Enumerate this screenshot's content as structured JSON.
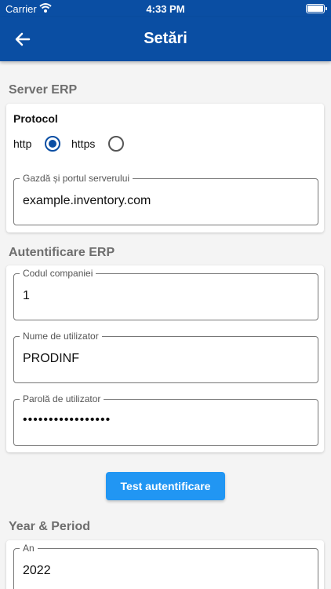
{
  "status_bar": {
    "carrier": "Carrier",
    "time": "4:33 PM"
  },
  "app_bar": {
    "title": "Setări"
  },
  "server_erp": {
    "section_title": "Server ERP",
    "protocol": {
      "label": "Protocol",
      "options": [
        {
          "label": "http",
          "selected": true
        },
        {
          "label": "https",
          "selected": false
        }
      ]
    },
    "host_field": {
      "label": "Gazdă și portul serverului",
      "value": "example.inventory.com"
    }
  },
  "auth_erp": {
    "section_title": "Autentificare ERP",
    "company_field": {
      "label": "Codul companiei",
      "value": "1"
    },
    "username_field": {
      "label": "Nume de utilizator",
      "value": "PRODINF"
    },
    "password_field": {
      "label": "Parolă de utilizator",
      "value": "•••••••••••••••••"
    },
    "test_button": "Test autentificare"
  },
  "year_period": {
    "section_title": "Year & Period",
    "year_field": {
      "label": "An",
      "value": "2022"
    }
  },
  "colors": {
    "primary": "#0a4ea3",
    "button": "#2196f3",
    "background": "#f4f4f4"
  }
}
